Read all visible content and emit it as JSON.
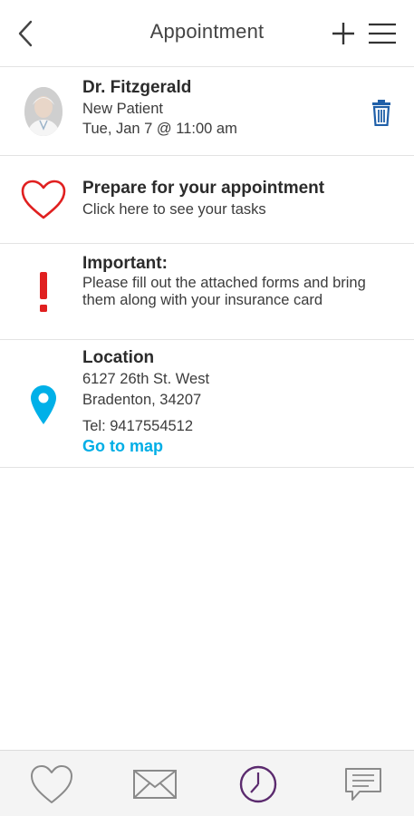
{
  "header": {
    "title": "Appointment",
    "back_icon": "chevron-left-icon",
    "add_icon": "plus-icon",
    "menu_icon": "hamburger-menu-icon"
  },
  "appointment": {
    "doctor": "Dr. Fitzgerald",
    "type": "New Patient",
    "datetime": "Tue, Jan 7 @ 11:00 am",
    "delete_icon": "trash-icon"
  },
  "prepare": {
    "title": "Prepare for your appointment",
    "subtitle": "Click here to see your tasks",
    "icon": "heart-outline-icon"
  },
  "important": {
    "title": "Important:",
    "text": "Please fill out the attached forms and bring them along with your insurance card",
    "icon": "exclamation-icon"
  },
  "location": {
    "title": "Location",
    "address_line1": "6127 26th St. West",
    "address_line2": "Bradenton, 34207",
    "phone": "Tel: 9417554512",
    "map_link": "Go to map",
    "icon": "map-pin-icon"
  },
  "tabs": [
    {
      "icon": "heart-icon"
    },
    {
      "icon": "envelope-icon"
    },
    {
      "icon": "clock-icon",
      "active": true
    },
    {
      "icon": "chat-icon"
    }
  ],
  "colors": {
    "heart": "#e02020",
    "exclamation": "#e02020",
    "pin": "#00b0e8",
    "link": "#00aee6",
    "trash": "#1f5fa8",
    "active_tab": "#5b2a6e",
    "inactive_tab": "#8a8a8a"
  }
}
